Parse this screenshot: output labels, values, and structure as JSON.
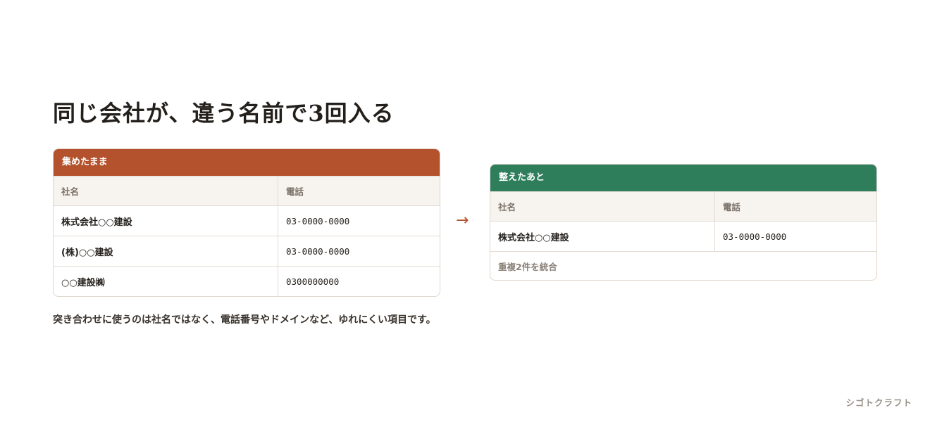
{
  "title": "同じ会社が、違う名前で3回入る",
  "before": {
    "label": "集めたまま",
    "columns": [
      "社名",
      "電話"
    ],
    "rows": [
      {
        "company": "株式会社○○建設",
        "phone": "03-0000-0000"
      },
      {
        "company": "(株)○○建設",
        "phone": "03-0000-0000"
      },
      {
        "company": "○○建設㈱",
        "phone": "0300000000"
      }
    ]
  },
  "arrow": "→",
  "after": {
    "label": "整えたあと",
    "columns": [
      "社名",
      "電話"
    ],
    "rows": [
      {
        "company": "株式会社○○建設",
        "phone": "03-0000-0000"
      }
    ],
    "note": "重複2件を統合"
  },
  "caption": "突き合わせに使うのは社名ではなく、電話番号やドメインなど、ゆれにくい項目です。",
  "brand": "シゴトクラフト",
  "colors": {
    "before_accent": "#b5522e",
    "after_accent": "#2e7d5b"
  }
}
